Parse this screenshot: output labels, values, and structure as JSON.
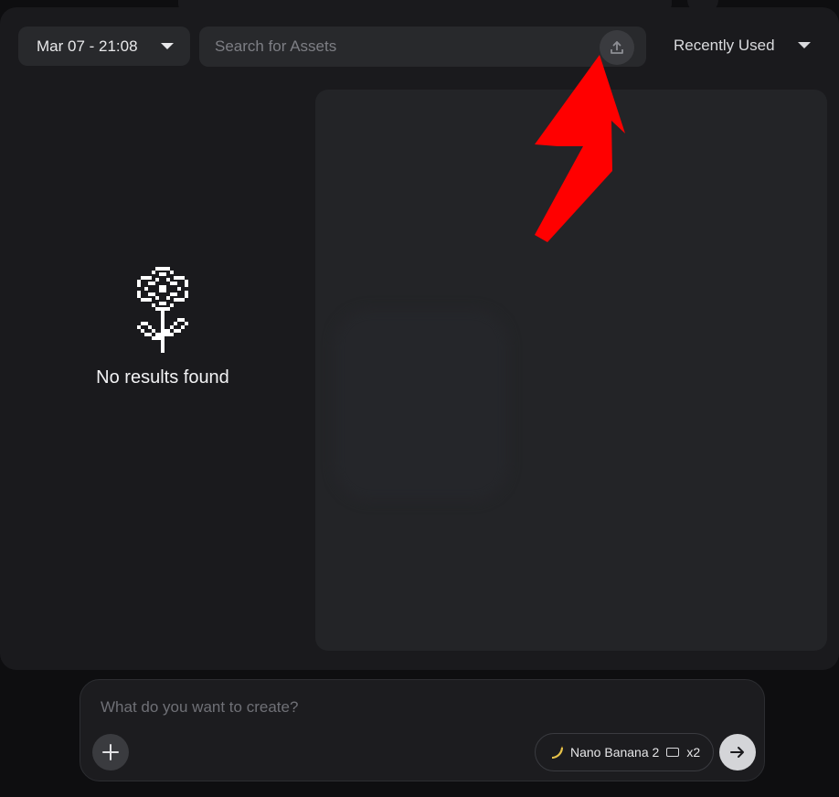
{
  "header": {
    "date_label": "Mar 07 - 21:08",
    "search_placeholder": "Search for Assets",
    "search_value": "",
    "sort_label": "Recently Used"
  },
  "empty_state": {
    "message": "No results found"
  },
  "composer": {
    "placeholder": "What do you want to create?",
    "value": "",
    "model_name": "Nano Banana 2",
    "count_label": "x2"
  },
  "icons": {
    "upload": "upload-icon",
    "flower": "pixel-flower-icon",
    "plus": "plus-icon",
    "banana": "banana-icon",
    "aspect": "aspect-ratio-icon",
    "send": "arrow-right-icon",
    "annotation": "red-arrow-annotation"
  },
  "colors": {
    "panel_bg": "#1a1a1d",
    "control_bg": "#28292c",
    "preview_bg": "#232427",
    "text_primary": "#e8e8ea",
    "annotation_red": "#ff0000",
    "send_bg": "#d4d5d8"
  }
}
